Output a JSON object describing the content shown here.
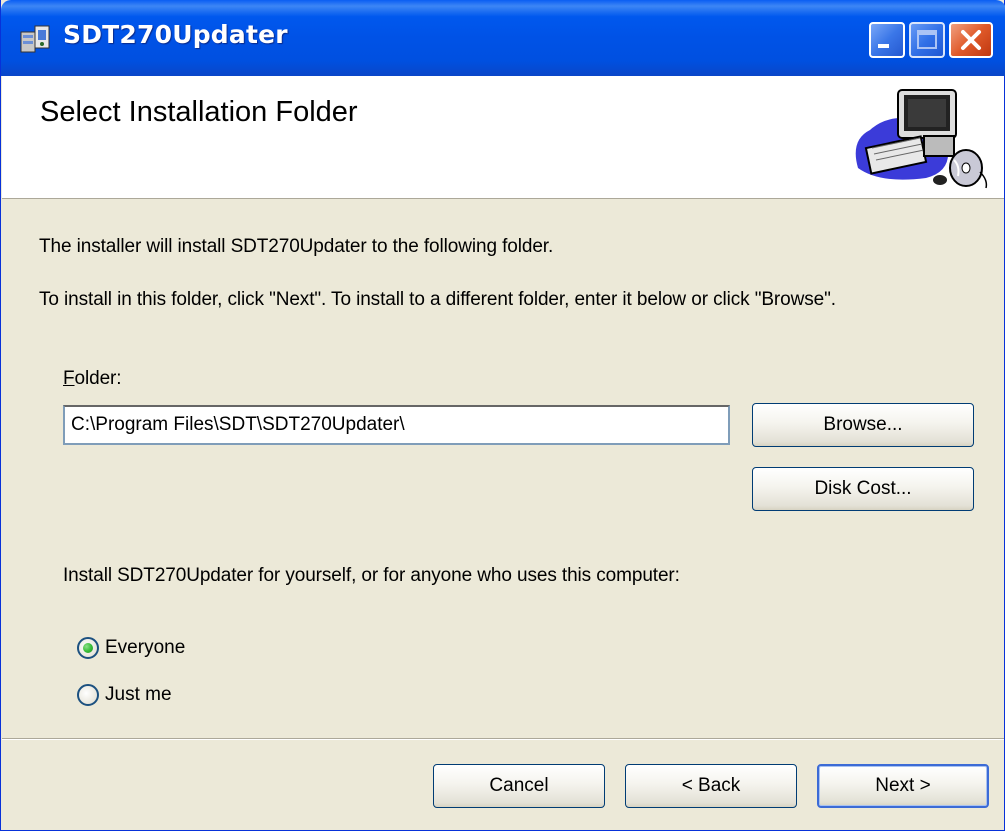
{
  "window": {
    "title": "SDT270Updater",
    "controls": {
      "minimize": "minimize",
      "maximize": "maximize",
      "close": "close"
    }
  },
  "header": {
    "title": "Select Installation Folder",
    "art_icon": "computer-with-cd-icon"
  },
  "body": {
    "line1": "The installer will install SDT270Updater to the following folder.",
    "line2": "To install in this folder, click \"Next\". To install to a different folder, enter it below or click \"Browse\".",
    "folder_label_accel": "F",
    "folder_label_rest": "older:",
    "folder_value": "C:\\Program Files\\SDT\\SDT270Updater\\",
    "browse_label": "Browse...",
    "disk_cost_label": "Disk Cost...",
    "scope_prompt": "Install SDT270Updater for yourself, or for anyone who uses this computer:",
    "options": [
      {
        "label": "Everyone",
        "checked": true
      },
      {
        "label": "Just me",
        "checked": false
      }
    ]
  },
  "footer": {
    "cancel_label": "Cancel",
    "back_label": "< Back",
    "next_label": "Next >"
  },
  "colors": {
    "titlebar": "#0054e3",
    "dialog_bg": "#ece9d8",
    "header_bg": "#ffffff",
    "radio_dot": "#3bbf3b"
  }
}
